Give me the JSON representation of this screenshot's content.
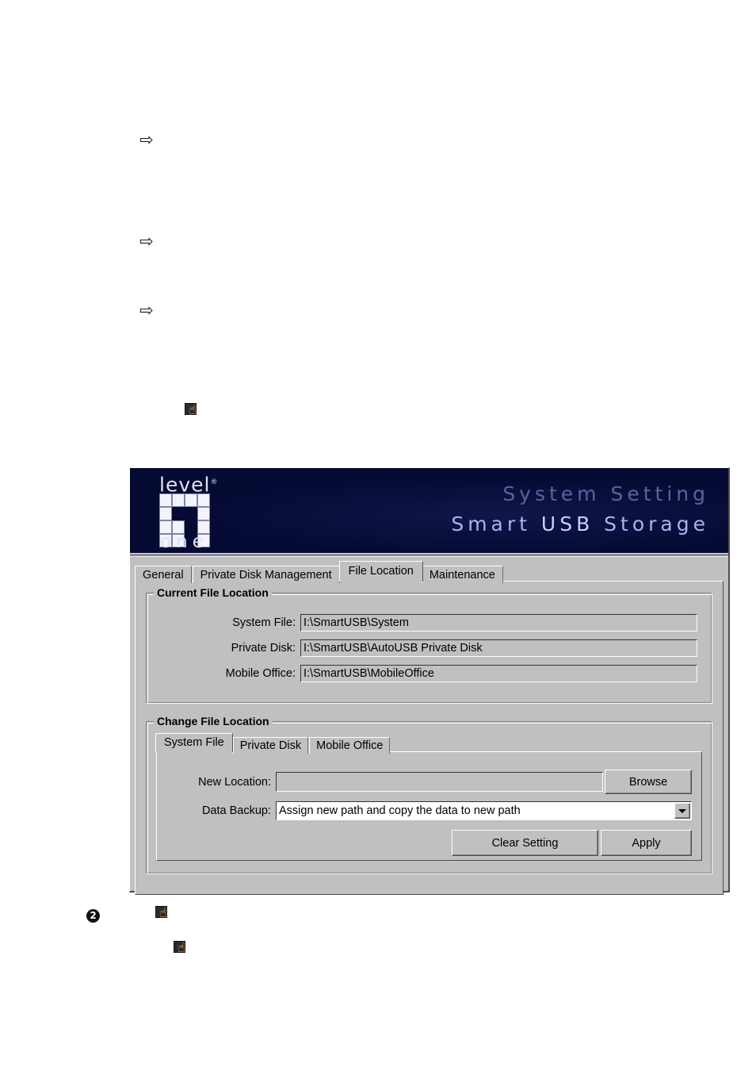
{
  "page": {
    "markers": {
      "arrow_glyph": "⇨",
      "step_number": "2",
      "hand_glyph": "☝"
    }
  },
  "window": {
    "banner": {
      "logo": {
        "word_top": "level",
        "registered_mark": "®",
        "word_bottom": "one",
        "grid_rows": [
          [
            1,
            1,
            1,
            1
          ],
          [
            1,
            0,
            0,
            1
          ],
          [
            1,
            1,
            0,
            1
          ],
          [
            1,
            1,
            0,
            1
          ]
        ]
      },
      "title_line_1": "System Setting",
      "title_line_2_part_1": "Smart ",
      "title_line_2_highlight": "USB",
      "title_line_2_part_2": " Storage",
      "colors": {
        "background": "#050a33",
        "title_1": "#5a639b",
        "title_2": "#aab3f0"
      }
    },
    "tabs": [
      {
        "label": "General",
        "active": false
      },
      {
        "label": "Private Disk Management",
        "active": false
      },
      {
        "label": "File Location",
        "active": true
      },
      {
        "label": "Maintenance",
        "active": false
      }
    ],
    "current_file_location": {
      "title": "Current File Location",
      "fields": [
        {
          "label": "System File:",
          "value": "I:\\SmartUSB\\System"
        },
        {
          "label": "Private Disk:",
          "value": "I:\\SmartUSB\\AutoUSB Private Disk"
        },
        {
          "label": "Mobile Office:",
          "value": "I:\\SmartUSB\\MobileOffice"
        }
      ]
    },
    "change_file_location": {
      "title": "Change File Location",
      "inner_tabs": [
        {
          "label": "System File",
          "active": true
        },
        {
          "label": "Private Disk",
          "active": false
        },
        {
          "label": "Mobile Office",
          "active": false
        }
      ],
      "new_location": {
        "label": "New Location:",
        "value": "",
        "placeholder": ""
      },
      "browse_button": "Browse",
      "data_backup": {
        "label": "Data Backup:",
        "selected": "Assign new path and copy the data to new path",
        "options": [
          "Assign new path and copy the data to new path"
        ]
      },
      "clear_button": "Clear Setting",
      "apply_button": "Apply"
    }
  }
}
